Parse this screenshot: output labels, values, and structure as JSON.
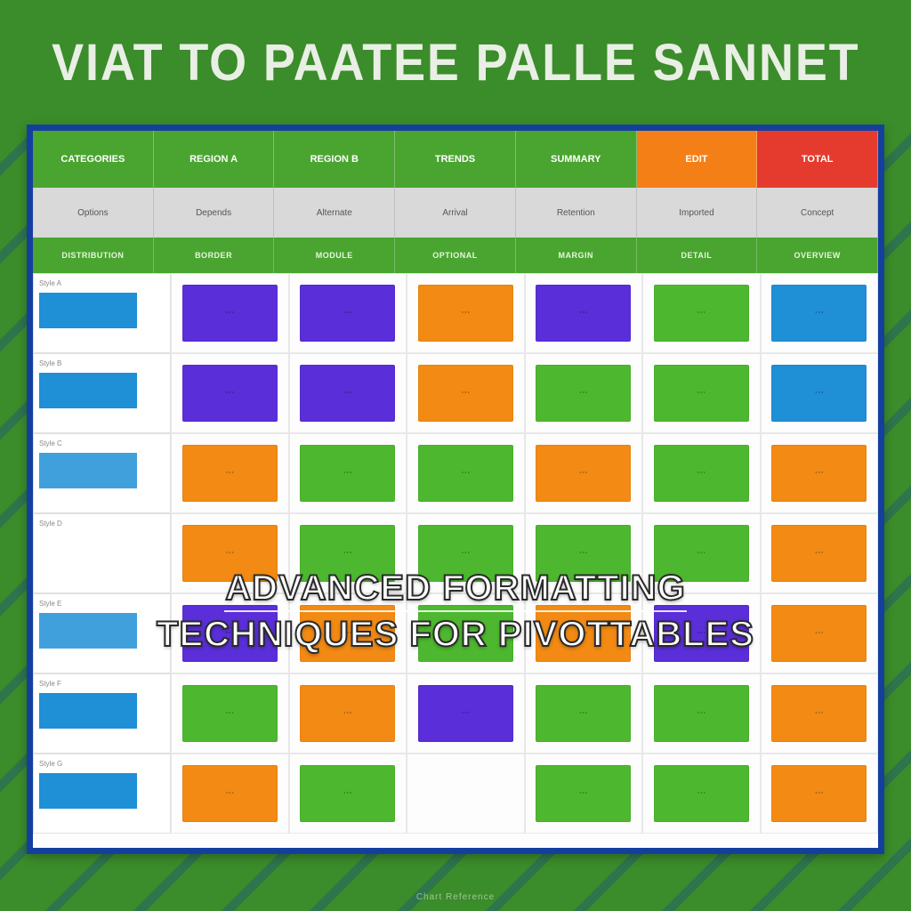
{
  "banner": {
    "title": "VIAT TO PAATEE PALLE SANNET"
  },
  "toprow": [
    {
      "label": "CATEGORIES",
      "cls": "green"
    },
    {
      "label": "REGION A",
      "cls": "green"
    },
    {
      "label": "REGION B",
      "cls": "green"
    },
    {
      "label": "TRENDS",
      "cls": "green"
    },
    {
      "label": "SUMMARY",
      "cls": "green"
    },
    {
      "label": "EDIT",
      "cls": "orange"
    },
    {
      "label": "TOTAL",
      "cls": "red"
    }
  ],
  "sub1": [
    "Options",
    "Depends",
    "Alternate",
    "Arrival",
    "Retention",
    "Imported",
    "Concept"
  ],
  "sub2": [
    "DISTRIBUTION",
    "BORDER",
    "MODULE",
    "OPTIONAL",
    "MARGIN",
    "DETAIL",
    "OVERVIEW"
  ],
  "rows": [
    {
      "label": "Style A",
      "blk": "blue",
      "tiles": [
        "purple",
        "purple",
        "orange",
        "purple",
        "green",
        "blue"
      ]
    },
    {
      "label": "Style B",
      "blk": "blue",
      "tiles": [
        "purple",
        "purple",
        "orange",
        "green",
        "green",
        "blue"
      ]
    },
    {
      "label": "Style C",
      "blk": "lblue",
      "tiles": [
        "orange",
        "green",
        "green",
        "orange",
        "green",
        "orange"
      ]
    },
    {
      "label": "Style D",
      "blk": "empty",
      "tiles": [
        "orange",
        "green",
        "green",
        "green",
        "green",
        "orange"
      ]
    },
    {
      "label": "Style E",
      "blk": "lblue",
      "tiles": [
        "purple",
        "orange",
        "green",
        "orange",
        "purple",
        "orange"
      ]
    },
    {
      "label": "Style F",
      "blk": "blue",
      "tiles": [
        "green",
        "orange",
        "purple",
        "green",
        "green",
        "orange"
      ]
    },
    {
      "label": "Style G",
      "blk": "blue",
      "tiles": [
        "orange",
        "green",
        "empty",
        "green",
        "green",
        "orange"
      ]
    }
  ],
  "overlay": {
    "l1": "ADVANCED FORMATTING",
    "l2": "TECHNIQUES FOR PIVOTTABLES"
  },
  "footer": "Chart Reference"
}
